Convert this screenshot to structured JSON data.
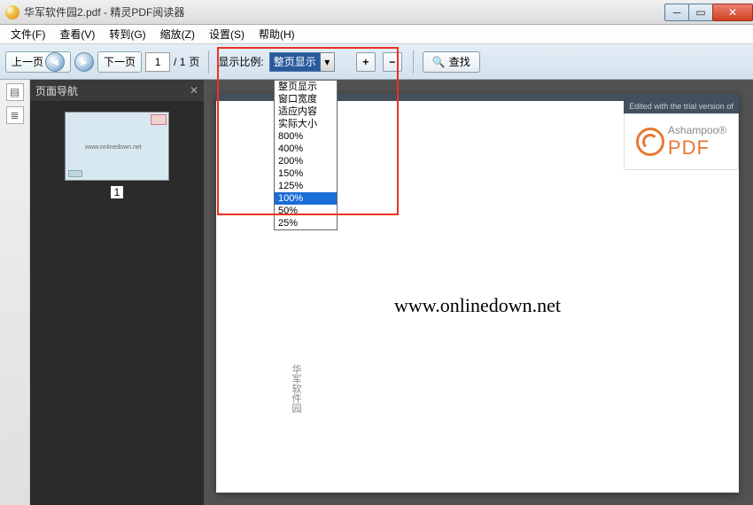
{
  "title": "华军软件园2.pdf - 精灵PDF阅读器",
  "menu": {
    "file": "文件(F)",
    "view": "查看(V)",
    "goto": "转到(G)",
    "zoom": "缩放(Z)",
    "settings": "设置(S)",
    "help": "帮助(H)"
  },
  "toolbar": {
    "prev": "上一页",
    "next": "下一页",
    "page_current": "1",
    "page_sep": "/ 1",
    "page_unit": "页",
    "zoom_label": "显示比例:",
    "zoom_value": "整页显示",
    "search": "查找"
  },
  "zoom_options": [
    {
      "label": "整页显示",
      "sel": false
    },
    {
      "label": "窗口宽度",
      "sel": false
    },
    {
      "label": "适应内容",
      "sel": false
    },
    {
      "label": "实际大小",
      "sel": false
    },
    {
      "label": "800%",
      "sel": false
    },
    {
      "label": "400%",
      "sel": false
    },
    {
      "label": "200%",
      "sel": false
    },
    {
      "label": "150%",
      "sel": false
    },
    {
      "label": "125%",
      "sel": false
    },
    {
      "label": "100%",
      "sel": true
    },
    {
      "label": "50%",
      "sel": false
    },
    {
      "label": "25%",
      "sel": false
    }
  ],
  "sidebar": {
    "title": "页面导航",
    "page_num": "1"
  },
  "page": {
    "url": "www.onlinedown.net",
    "vtext": "华军软件园",
    "wm_head": "Edited with the trial version of",
    "wm_brand1": "Ashampoo®",
    "wm_brand2": "PDF"
  }
}
